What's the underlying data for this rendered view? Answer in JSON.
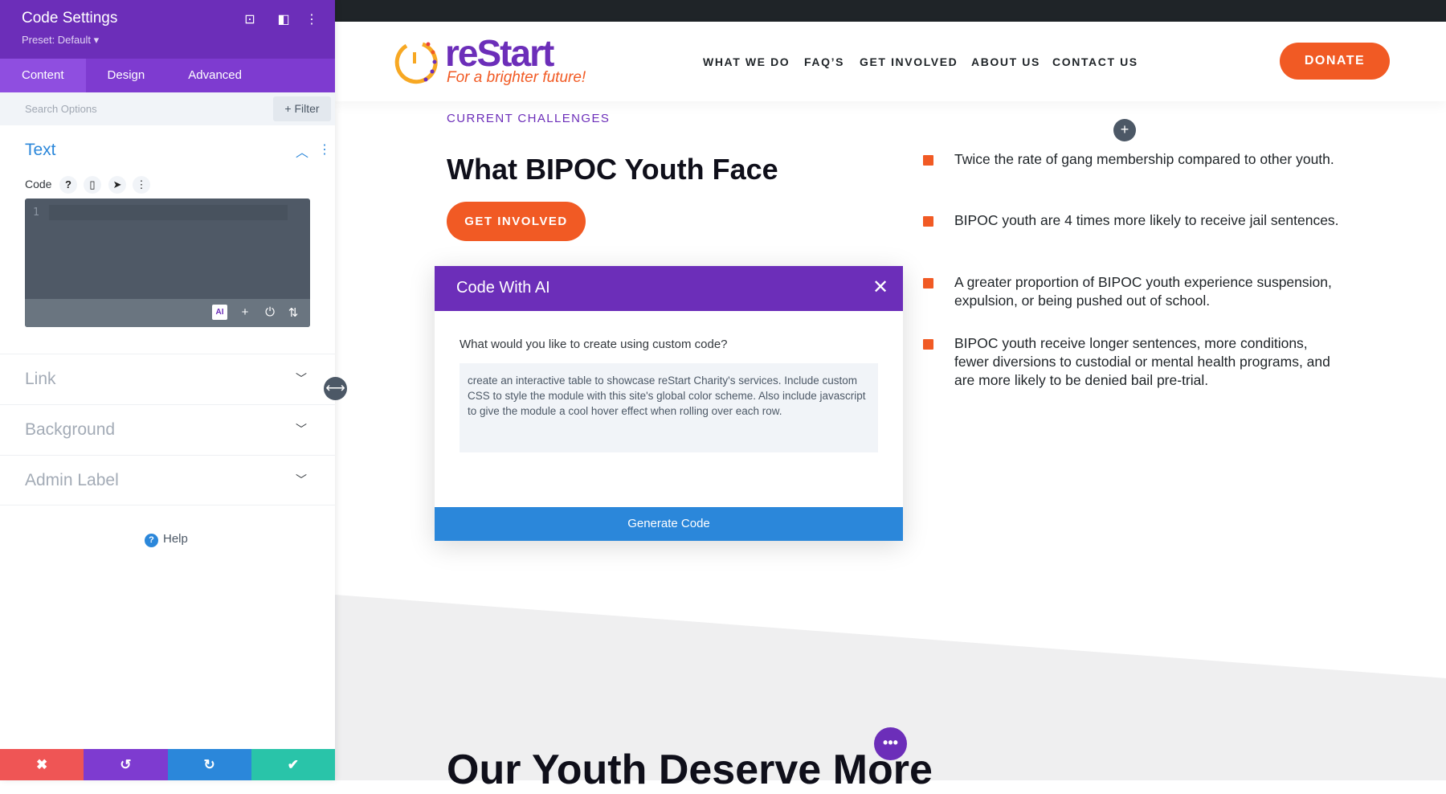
{
  "panel": {
    "title": "Code Settings",
    "preset": "Preset: Default ▾",
    "tabs": [
      "Content",
      "Design",
      "Advanced"
    ],
    "search_placeholder": "Search Options",
    "filter": "+ Filter",
    "section_text": "Text",
    "code_label": "Code",
    "line_number": "1",
    "ai_badge": "AI",
    "sections": [
      "Link",
      "Background",
      "Admin Label"
    ],
    "help": "Help"
  },
  "colors": {
    "purple": "#6c2eb9",
    "orange": "#f15a24",
    "blue": "#2b87da",
    "red": "#ef5555",
    "green": "#29c4a9"
  },
  "site": {
    "logo_name": "reStart",
    "logo_tagline": "For a brighter future!",
    "nav": [
      "WHAT WE DO",
      "FAQ’S",
      "GET INVOLVED",
      "ABOUT US",
      "CONTACT US"
    ],
    "donate": "DONATE",
    "eyebrow": "CURRENT CHALLENGES",
    "heading": "What BIPOC Youth Face",
    "cta": "GET INVOLVED",
    "bullets": [
      "Twice the rate of gang membership compared to other youth.",
      "BIPOC youth are 4 times more likely to receive jail sentences.",
      "A greater proportion of BIPOC youth experience suspension, expulsion, or being pushed out of school.",
      "BIPOC youth receive longer sentences, more conditions, fewer diversions to custodial or mental health programs, and are more likely to be denied bail pre-trial."
    ],
    "heading2": "Our Youth Deserve More"
  },
  "modal": {
    "title": "Code With AI",
    "prompt_label": "What would you like to create using custom code?",
    "prompt_value": "create an interactive table to showcase reStart Charity's services. Include custom CSS to style the module with this site's global color scheme. Also include javascript to give the module a cool hover effect when rolling over each row.",
    "generate": "Generate Code"
  }
}
